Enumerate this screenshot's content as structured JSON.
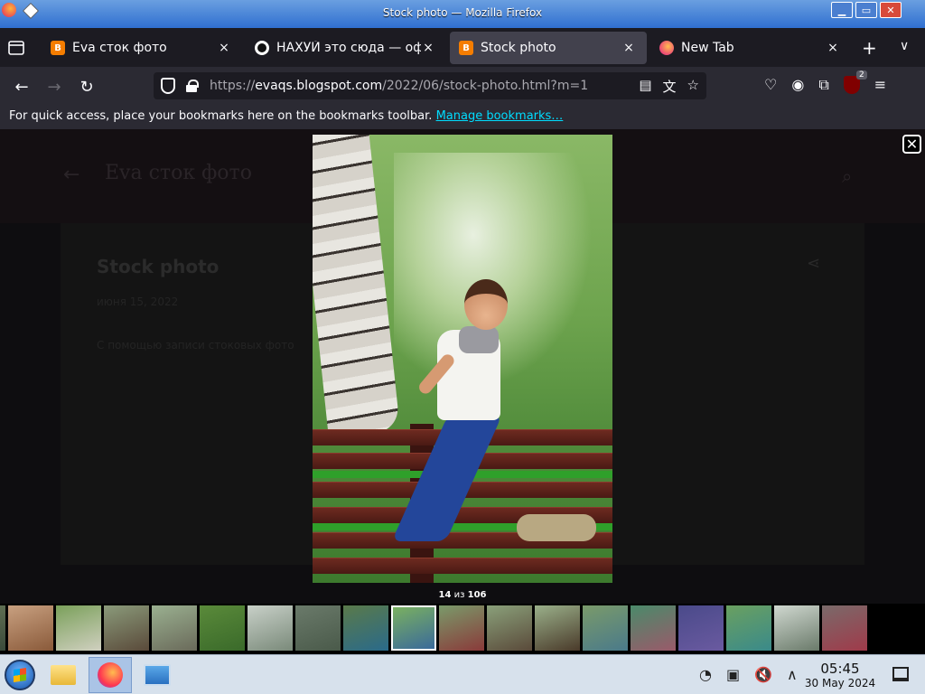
{
  "window": {
    "title": "Stock photo — Mozilla Firefox"
  },
  "tabs": [
    {
      "label": "Eva сток фото",
      "favicon": "blogger-icon",
      "active": false
    },
    {
      "label": "НАХУЙ это сюда — офи",
      "favicon": "circle-icon",
      "active": false
    },
    {
      "label": "Stock photo",
      "favicon": "blogger-icon",
      "active": true
    },
    {
      "label": "New Tab",
      "favicon": "firefox-icon",
      "active": false
    }
  ],
  "tab_close_glyph": "×",
  "newtab_glyph": "+",
  "alltabs_glyph": "∨",
  "nav": {
    "back_glyph": "←",
    "forward_glyph": "→",
    "reload_glyph": "↻",
    "url_prefix": "https://",
    "url_host": "evaqs.blogspot.com",
    "url_path": "/2022/06/stock-photo.html?m=1",
    "ublock_count": "2"
  },
  "bookmarks": {
    "text": "For quick access, place your bookmarks here on the bookmarks toolbar.",
    "link": "Manage bookmarks…"
  },
  "page": {
    "back_glyph": "←",
    "blog_title": "Eva сток фото",
    "post_title": "Stock photo",
    "post_meta": "июня 15, 2022",
    "post_body": "С помощью записи стоковых фото",
    "share_glyph": "⋖"
  },
  "lightbox": {
    "close_glyph": "✕",
    "counter_current": "14",
    "counter_sep": " из ",
    "counter_total": "106"
  },
  "thumbnails": [
    {
      "colors": [
        "#6a7a5a",
        "#3a4a3a"
      ]
    },
    {
      "colors": [
        "#c8a080",
        "#8a5a3a"
      ]
    },
    {
      "colors": [
        "#7aa05a",
        "#d0d0c0"
      ]
    },
    {
      "colors": [
        "#8a9a7a",
        "#5a4a3a"
      ]
    },
    {
      "colors": [
        "#9ab090",
        "#6a6a5a"
      ]
    },
    {
      "colors": [
        "#5a8a3a",
        "#3a6a2a"
      ]
    },
    {
      "colors": [
        "#c8d0c8",
        "#7a8a7a"
      ]
    },
    {
      "colors": [
        "#6a7a6a",
        "#4a5a4a"
      ]
    },
    {
      "colors": [
        "#5a7a4a",
        "#2a6a8a"
      ]
    },
    {
      "colors": [
        "#7ab060",
        "#3a6a9a"
      ]
    },
    {
      "colors": [
        "#7a9a6a",
        "#8a3a3a"
      ]
    },
    {
      "colors": [
        "#8aa07a",
        "#5a4a3a"
      ]
    },
    {
      "colors": [
        "#9ab08a",
        "#4a3a2a"
      ]
    },
    {
      "colors": [
        "#7a9a6a",
        "#4a7a8a"
      ]
    },
    {
      "colors": [
        "#4a8a6a",
        "#9a5a6a"
      ]
    },
    {
      "colors": [
        "#4a4a8a",
        "#6a5aa0"
      ]
    },
    {
      "colors": [
        "#6aa060",
        "#3a8a8a"
      ]
    },
    {
      "colors": [
        "#d0d8d0",
        "#6a7a6a"
      ]
    },
    {
      "colors": [
        "#7a6a6a",
        "#a03a4a"
      ]
    }
  ],
  "current_thumb_index": 9,
  "taskbar": {
    "time": "05:45",
    "date": "30 May 2024"
  }
}
